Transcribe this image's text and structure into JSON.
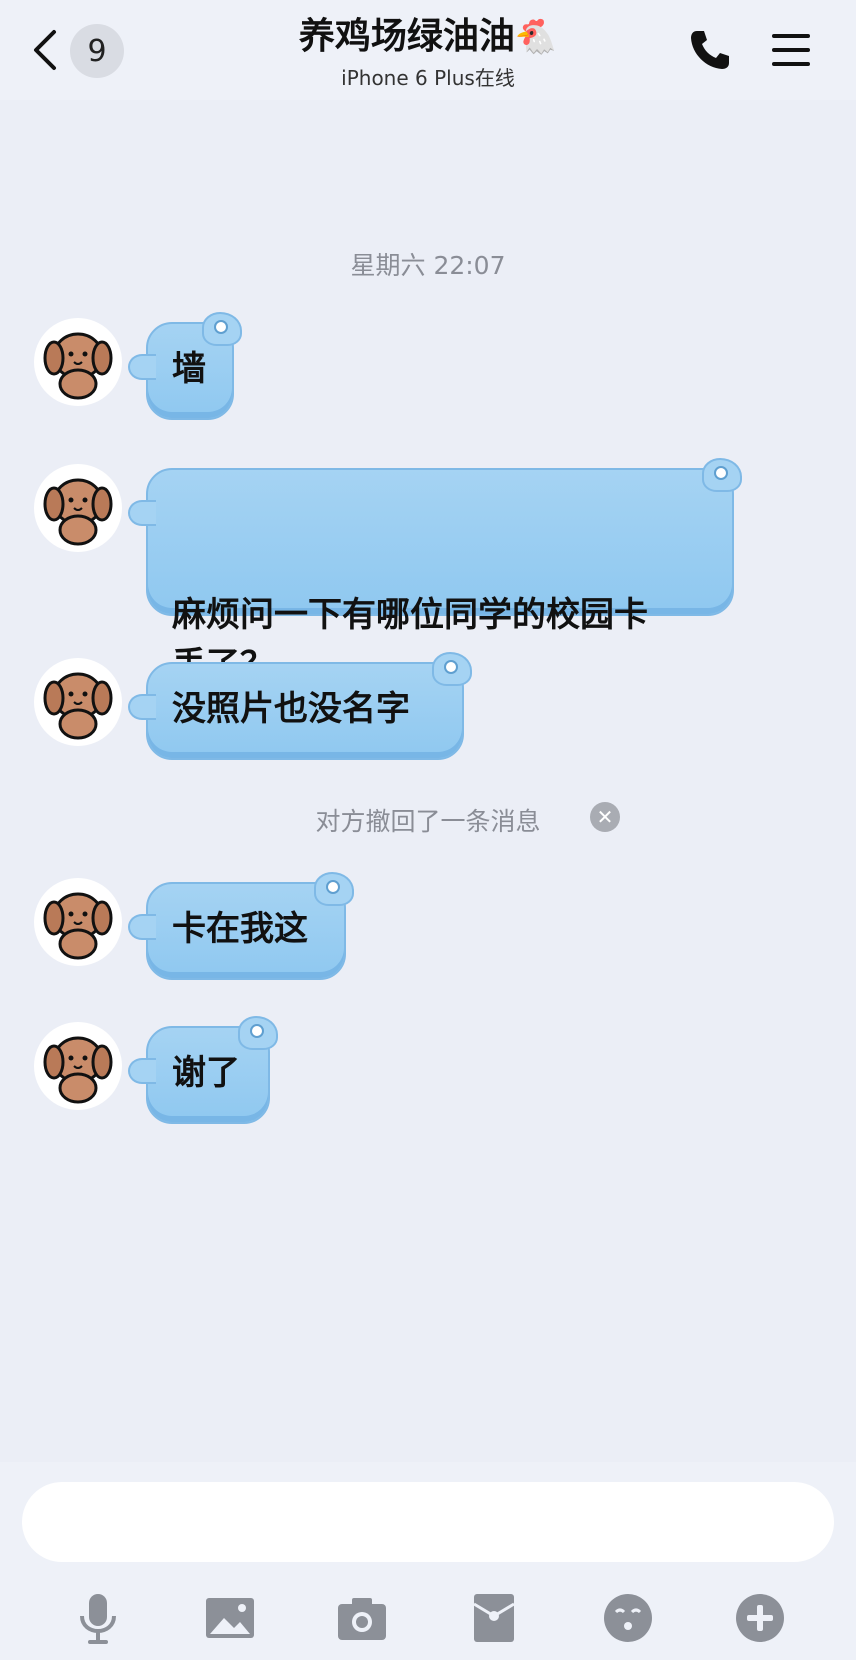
{
  "header": {
    "unread_count": "9",
    "title": "养鸡场绿油油",
    "title_emoji": "🐔",
    "subtitle": "iPhone 6 Plus在线"
  },
  "chat": {
    "timestamp": "星期六 22:07",
    "messages": [
      {
        "text": "墙"
      },
      {
        "text": "麻烦问一下有哪位同学的校园卡\n丢了？"
      },
      {
        "text": "没照片也没名字"
      },
      {
        "text": "卡在我这"
      },
      {
        "text": "谢了"
      }
    ],
    "recall_notice": "对方撤回了一条消息"
  },
  "input": {
    "placeholder": ""
  },
  "toolbar": [
    "mic-icon",
    "image-icon",
    "camera-icon",
    "red-packet-icon",
    "emoji-icon",
    "plus-icon"
  ],
  "colors": {
    "background": "#ebeef6",
    "bubble": "#a5d3f3",
    "bubble_border": "#7fb9e6"
  }
}
